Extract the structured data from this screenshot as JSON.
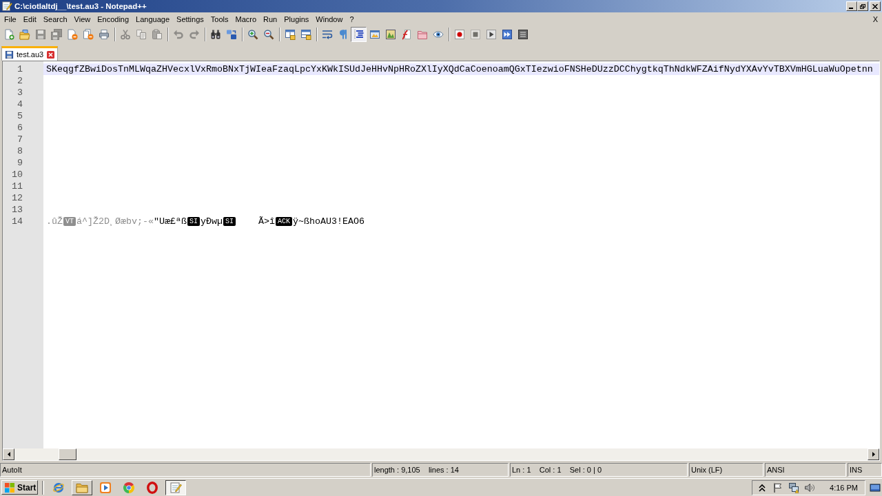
{
  "window": {
    "title": "C:\\ciotlaltdj__\\test.au3 - Notepad++"
  },
  "menu": {
    "items": [
      "File",
      "Edit",
      "Search",
      "View",
      "Encoding",
      "Language",
      "Settings",
      "Tools",
      "Macro",
      "Run",
      "Plugins",
      "Window",
      "?"
    ],
    "close": "X"
  },
  "toolbar": [
    [
      {
        "disabled": false,
        "pressed": false
      },
      {
        "disabled": false,
        "pressed": false
      },
      {
        "disabled": true,
        "pressed": false
      },
      {
        "disabled": true,
        "pressed": false
      },
      {
        "disabled": false,
        "pressed": false
      },
      {
        "disabled": false,
        "pressed": false
      },
      {
        "disabled": false,
        "pressed": false
      }
    ],
    [
      {
        "disabled": true,
        "pressed": false
      },
      {
        "disabled": true,
        "pressed": false
      },
      {
        "disabled": true,
        "pressed": false
      }
    ],
    [
      {
        "disabled": true,
        "pressed": false
      },
      {
        "disabled": true,
        "pressed": false
      }
    ],
    [
      {
        "disabled": false,
        "pressed": false
      },
      {
        "disabled": false,
        "pressed": false
      }
    ],
    [
      {
        "disabled": false,
        "pressed": false
      },
      {
        "disabled": false,
        "pressed": false
      }
    ],
    [
      {
        "disabled": false,
        "pressed": false
      },
      {
        "disabled": false,
        "pressed": false
      }
    ],
    [
      {
        "disabled": false,
        "pressed": false
      },
      {
        "disabled": false,
        "pressed": false
      },
      {
        "disabled": false,
        "pressed": true
      },
      {
        "disabled": false,
        "pressed": false
      },
      {
        "disabled": false,
        "pressed": false
      },
      {
        "disabled": false,
        "pressed": false
      },
      {
        "disabled": false,
        "pressed": false
      },
      {
        "disabled": false,
        "pressed": false
      }
    ],
    [
      {
        "disabled": false,
        "pressed": false
      },
      {
        "disabled": true,
        "pressed": false
      },
      {
        "disabled": false,
        "pressed": false
      },
      {
        "disabled": false,
        "pressed": false
      },
      {
        "disabled": false,
        "pressed": false
      }
    ]
  ],
  "tabs": [
    {
      "label": "test.au3",
      "selected": true
    }
  ],
  "editor": {
    "lines": [
      {
        "number": "1",
        "current": true,
        "segments": [
          {
            "kind": "text",
            "dimmed": false,
            "text": "SKeqgfZBwiDosTnMLWqaZHVecxlVxRmoBNxTjWIeaFzaqLpcYxKWkISUdJeHHvNpHRoZXlIyXQdCaCoenoamQGxTIezwioFNSHeDUzzDCChygtkqThNdkWFZAifNydYXAvYvTBXVmHGLuaWuOpetnn"
          }
        ]
      },
      {
        "number": "2",
        "current": false
      },
      {
        "number": "3",
        "current": false
      },
      {
        "number": "4",
        "current": false
      },
      {
        "number": "5",
        "current": false
      },
      {
        "number": "6",
        "current": false
      },
      {
        "number": "7",
        "current": false
      },
      {
        "number": "8",
        "current": false
      },
      {
        "number": "9",
        "current": false
      },
      {
        "number": "10",
        "current": false
      },
      {
        "number": "11",
        "current": false
      },
      {
        "number": "12",
        "current": false
      },
      {
        "number": "13",
        "current": false
      },
      {
        "number": "14",
        "current": false,
        "segments": [
          {
            "kind": "text",
            "dimmed": true,
            "text": ".ûŽ"
          },
          {
            "kind": "control",
            "dimmed": true,
            "text": "VT"
          },
          {
            "kind": "text",
            "dimmed": true,
            "text": "á^]Ž2D¸Øæbv;-«"
          },
          {
            "kind": "text",
            "dimmed": false,
            "text": "\"Uæ£ªß"
          },
          {
            "kind": "control",
            "dimmed": false,
            "text": "SI"
          },
          {
            "kind": "text",
            "dimmed": false,
            "text": "yÐwµ"
          },
          {
            "kind": "control",
            "dimmed": false,
            "text": "SI"
          },
          {
            "kind": "text",
            "dimmed": false,
            "text": "    Ã>î"
          },
          {
            "kind": "control",
            "dimmed": false,
            "text": "ACK"
          },
          {
            "kind": "text",
            "dimmed": false,
            "text": "ÿ~ßhoAU3!EAO6"
          }
        ]
      }
    ]
  },
  "status_bar": [
    "AutoIt",
    "length : 9,105    lines : 14",
    "Ln : 1    Col : 1    Sel : 0 | 0",
    "Unix (LF)",
    "ANSI",
    "INS"
  ],
  "taskbar": {
    "start": "Start",
    "apps": [
      {
        "running": false,
        "selected": false
      },
      {
        "running": true,
        "selected": false
      },
      {
        "running": false,
        "selected": false
      },
      {
        "running": false,
        "selected": false
      },
      {
        "running": false,
        "selected": false
      },
      {
        "running": true,
        "selected": true
      }
    ],
    "clock": "4:16 PM"
  }
}
